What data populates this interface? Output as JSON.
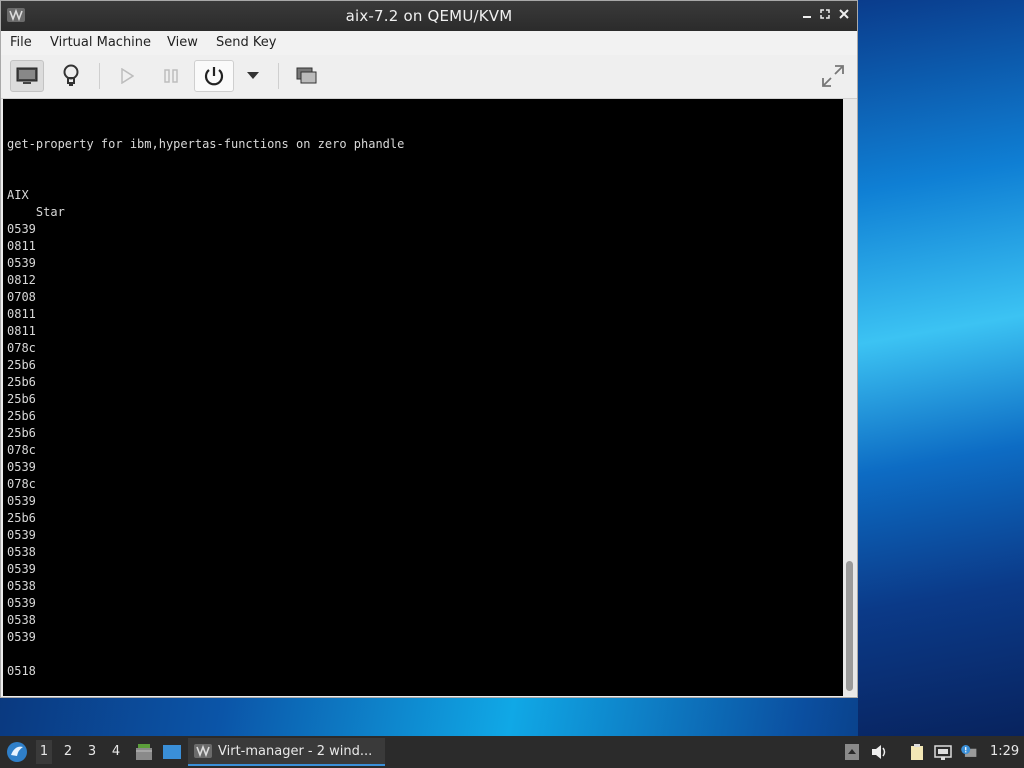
{
  "window": {
    "title": "aix-7.2 on QEMU/KVM"
  },
  "menu": {
    "items": [
      "File",
      "Virtual Machine",
      "View",
      "Send Key"
    ]
  },
  "toolbar": {
    "buttons": [
      "show-console-icon",
      "details-lightbulb-icon",
      "run-icon",
      "pause-icon",
      "power-icon",
      "dropdown-arrow-icon",
      "snapshots-icon",
      "fullscreen-icon"
    ]
  },
  "console": {
    "lines": [
      "get-property for ibm,hypertas-functions on zero phandle",
      "",
      "",
      "AIX",
      "    Star",
      "0539",
      "0811",
      "0539",
      "0812",
      "0708",
      "0811",
      "0811",
      "078c",
      "25b6",
      "25b6",
      "25b6",
      "25b6",
      "25b6",
      "078c",
      "0539",
      "078c",
      "0539",
      "25b6",
      "0539",
      "0538",
      "0539",
      "0538",
      "0539",
      "0538",
      "0539",
      "",
      "0518"
    ]
  },
  "taskbar": {
    "workspaces": [
      "1",
      "2",
      "3",
      "4"
    ],
    "active_workspace": "1",
    "task_label": "Virt-manager - 2 wind...",
    "clock": "1:29"
  },
  "colors": {
    "accent": "#3a8fd8",
    "titlebar": "#2f2f2f",
    "taskbar": "#2b2b2b"
  }
}
